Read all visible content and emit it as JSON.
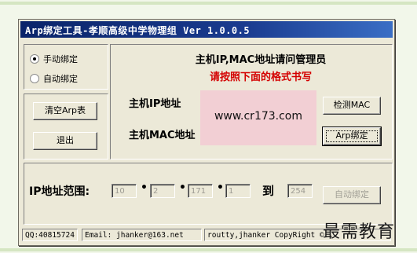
{
  "window": {
    "title": "Arp绑定工具-孝顺高级中学物理组 Ver 1.0.0.5"
  },
  "mode": {
    "options": [
      "手动绑定",
      "自动绑定"
    ],
    "selected": "手动绑定"
  },
  "left_buttons": {
    "clear_arp": "清空Arp表",
    "exit": "退出"
  },
  "header": {
    "title": "主机IP,MAC地址请问管理员",
    "instruction": "请按照下面的格式书写"
  },
  "fields": {
    "ip_label": "主机IP地址",
    "mac_label": "主机MAC地址",
    "preview_text": "www.cr173.com"
  },
  "right_buttons": {
    "detect_mac": "检测MAC",
    "arp_bind": "Arp绑定"
  },
  "ip_range": {
    "label": "IP地址范围:",
    "octets": [
      "10",
      "2",
      "171",
      "1"
    ],
    "to_label": "到",
    "end": "254",
    "auto_bind_button": "自动绑定"
  },
  "status_bar": {
    "qq": "QQ:40815724",
    "email": "Email: jhanker@163.net",
    "copyright": "routty,jhanker CopyRight ©"
  },
  "watermark": "最需教育",
  "colors": {
    "title_bar": "#0a246a",
    "instruction_text": "#d40000",
    "preview_bg": "#f2cfd4",
    "window_bg": "#ece9d8"
  }
}
